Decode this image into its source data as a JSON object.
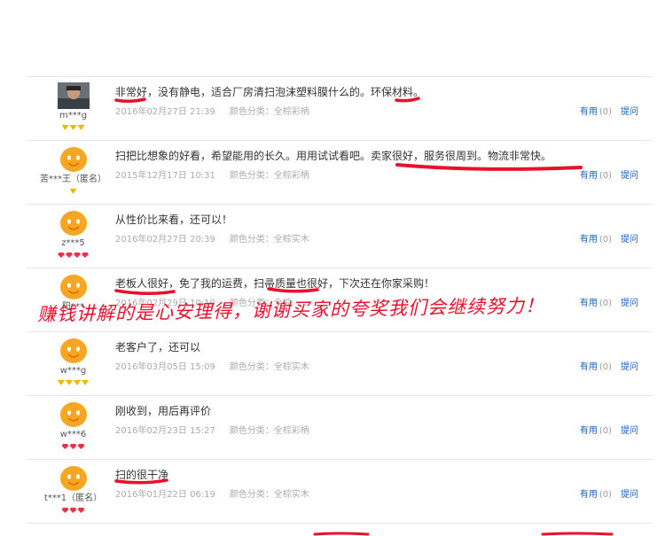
{
  "colors": {
    "link": "#1a62b7",
    "annotation": "#e8102a",
    "badge_gold": "#f5b400",
    "badge_red": "#e8324a"
  },
  "reviews": [
    {
      "avatar": "user-photo",
      "username": "m***g",
      "badge": "gold",
      "badge_count": 3,
      "content": "非常好，没有静电，适合厂房清扫泡沫塑料膜什么的。环保材料。",
      "date": "2016年02月27日 21:39",
      "attribute": "颜色分类：全棕彩柄",
      "useful_label": "有用",
      "useful_count": "(0)",
      "ask_label": "提问"
    },
    {
      "avatar": "default-avatar",
      "username": "苦***王（匿名）",
      "badge": "gold",
      "badge_count": 1,
      "content": "扫把比想象的好看，希望能用的长久。用用试试看吧。卖家很好，服务很周到。物流非常快。",
      "date": "2015年12月17日 10:31",
      "attribute": "颜色分类：全棕彩柄",
      "useful_label": "有用",
      "useful_count": "(0)",
      "ask_label": "提问"
    },
    {
      "avatar": "default-avatar",
      "username": "z***5",
      "badge": "red",
      "badge_count": 4,
      "content": "从性价比来看，还可以！",
      "date": "2016年02月27日 20:39",
      "attribute": "颜色分类：全棕实木",
      "useful_label": "有用",
      "useful_count": "(0)",
      "ask_label": "提问"
    },
    {
      "avatar": "default-avatar",
      "username": "阳***",
      "badge": "none",
      "badge_count": 0,
      "content": "老板人很好，免了我的运费，扫帚质量也很好，下次还在你家采购！",
      "date": "2016年02月29日 10:10",
      "attribute": "颜色分类：全棕",
      "useful_label": "有用",
      "useful_count": "(0)",
      "ask_label": "提问"
    },
    {
      "avatar": "default-avatar",
      "username": "w***g",
      "badge": "gold",
      "badge_count": 4,
      "content": "老客户了，还可以",
      "date": "2016年03月05日 15:09",
      "attribute": "颜色分类：全棕实木",
      "useful_label": "有用",
      "useful_count": "(0)",
      "ask_label": "提问"
    },
    {
      "avatar": "default-avatar",
      "username": "w***6",
      "badge": "red",
      "badge_count": 3,
      "content": "刚收到，用后再评价",
      "date": "2016年02月23日 15:27",
      "attribute": "颜色分类：全棕彩柄",
      "useful_label": "有用",
      "useful_count": "(0)",
      "ask_label": "提问"
    },
    {
      "avatar": "default-avatar",
      "username": "t***1（匿名）",
      "badge": "red",
      "badge_count": 3,
      "content": "扫的很干净",
      "date": "2016年01月22日 06:19",
      "attribute": "颜色分类：全棕实木",
      "useful_label": "有用",
      "useful_count": "(0)",
      "ask_label": "提问"
    }
  ],
  "overlay": {
    "text": "赚钱讲解的是心安理得，谢谢买家的夸奖我们会继续努力！"
  }
}
